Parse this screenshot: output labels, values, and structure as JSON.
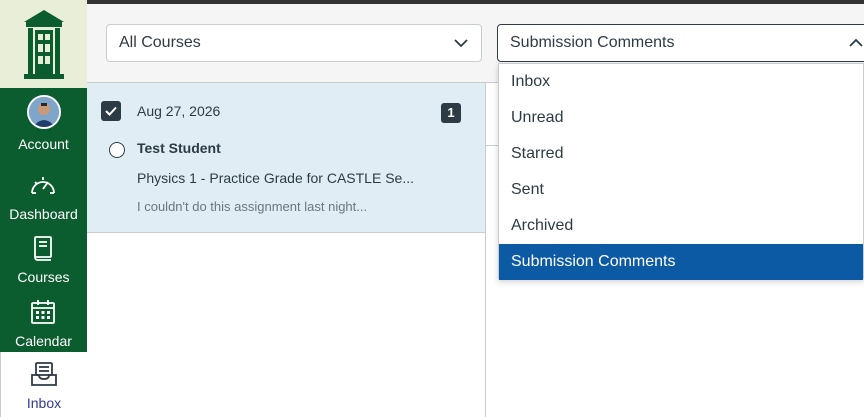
{
  "nav": {
    "items": [
      {
        "label": "Account",
        "icon": "avatar"
      },
      {
        "label": "Dashboard",
        "icon": "dashboard-icon"
      },
      {
        "label": "Courses",
        "icon": "courses-icon"
      },
      {
        "label": "Calendar",
        "icon": "calendar-icon"
      },
      {
        "label": "Inbox",
        "icon": "inbox-icon"
      }
    ],
    "active": "Inbox"
  },
  "filters": {
    "course_select_value": "All Courses",
    "mailbox_select_value": "Submission Comments"
  },
  "conversation": {
    "date": "Aug 27, 2026",
    "message_count": "1",
    "author": "Test Student",
    "subject": "Physics 1 - Practice Grade for CASTLE Se...",
    "preview": "I couldn't do this assignment last night...",
    "checked": true
  },
  "mailbox_menu": {
    "options": [
      "Inbox",
      "Unread",
      "Starred",
      "Sent",
      "Archived",
      "Submission Comments"
    ],
    "selected": "Submission Comments"
  },
  "colors": {
    "nav_background": "#0b5c2e",
    "logo_background": "#e9eed8",
    "selected_option": "#0b5aa3",
    "conversation_highlight": "#e0edf4"
  }
}
